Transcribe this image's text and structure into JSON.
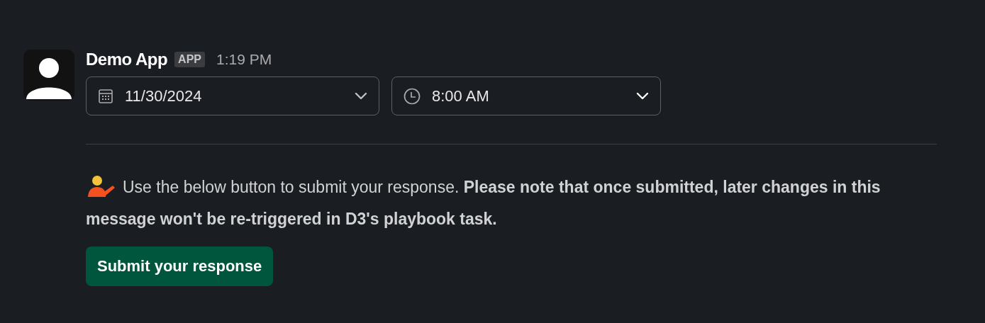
{
  "message": {
    "sender": "Demo App",
    "badge": "APP",
    "time": "1:19 PM"
  },
  "pickers": [
    {
      "kind": "date",
      "value": "11/30/2024"
    },
    {
      "kind": "time",
      "value": "8:00 AM"
    }
  ],
  "note": "Use the below button to submit your response. **Please note that once submitted, later changes in this message won't be re-triggered in D3's playbook task.**",
  "button": "Submit your response"
}
